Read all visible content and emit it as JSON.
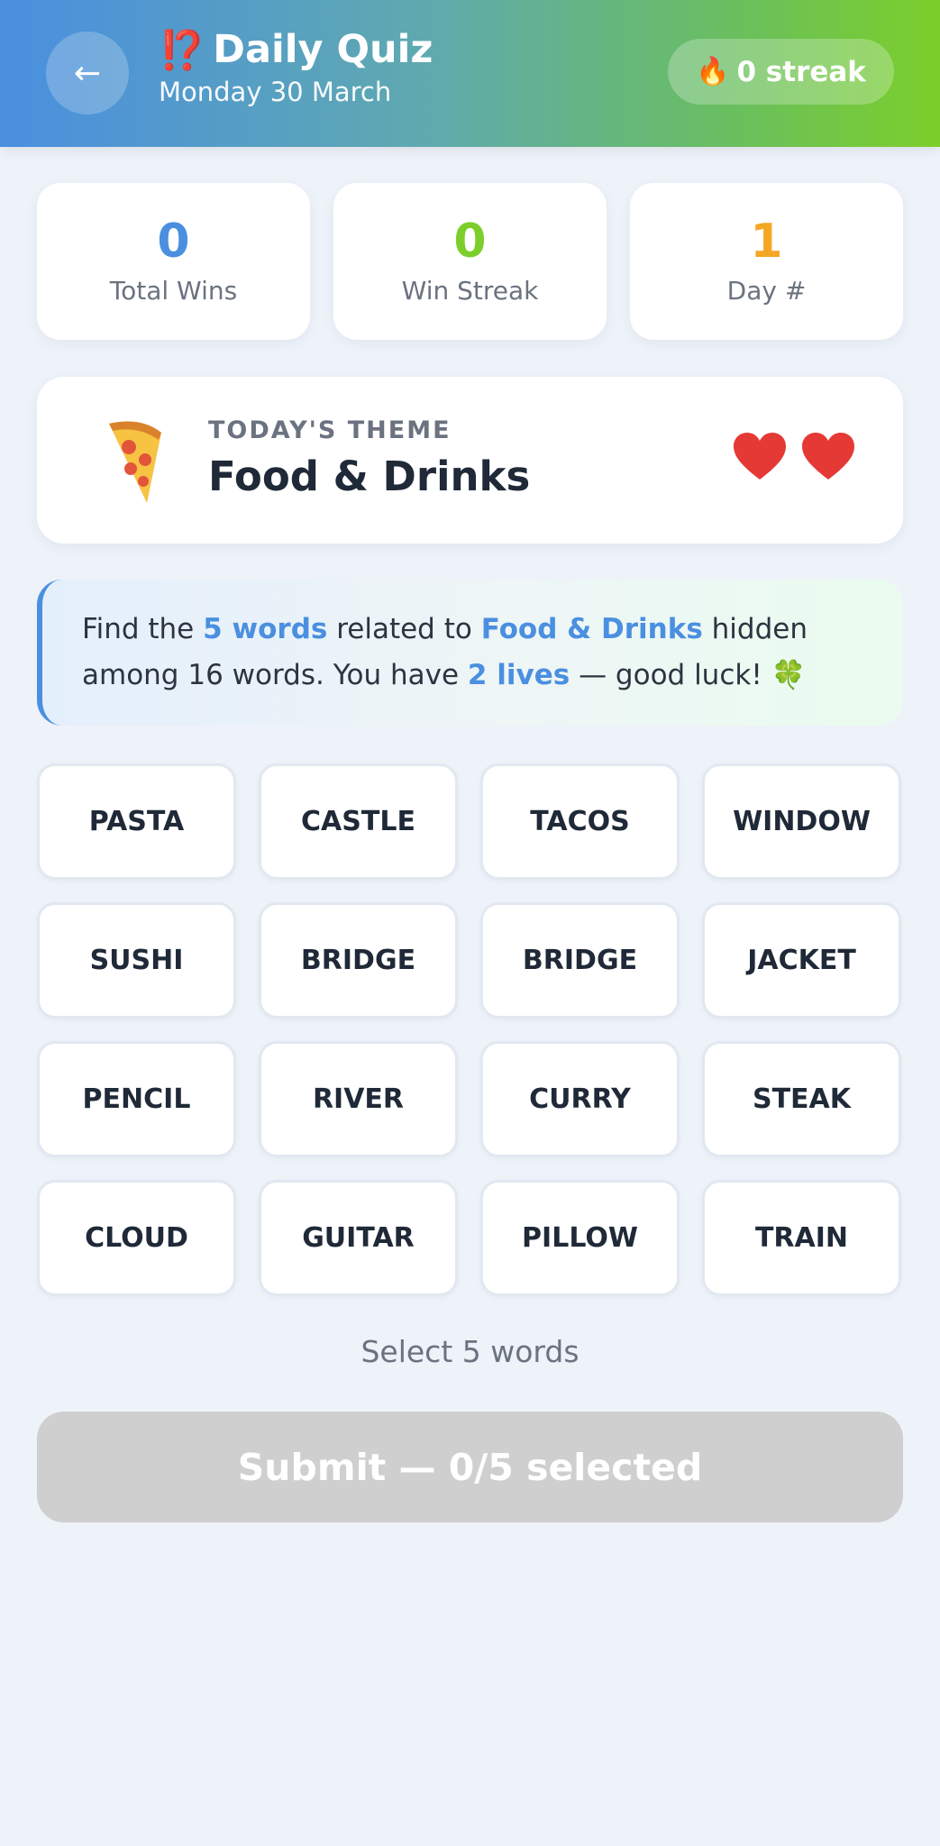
{
  "header": {
    "back_icon": "arrow-left-icon",
    "title_icon": "⁉️",
    "title": "Daily Quiz",
    "date": "Monday 30 March",
    "streak_icon": "fire-icon",
    "streak_label": "0 streak"
  },
  "stats": [
    {
      "value": "0",
      "label": "Total Wins",
      "color": "#4a8fe0"
    },
    {
      "value": "0",
      "label": "Win Streak",
      "color": "#7ccf2a"
    },
    {
      "value": "1",
      "label": "Day #",
      "color": "#f5a623"
    }
  ],
  "theme": {
    "icon": "pizza-icon",
    "label": "TODAY'S THEME",
    "name": "Food & Drinks",
    "lives": 2,
    "heart_icon": "heart-icon",
    "heart_color": "#e53935"
  },
  "instructions": {
    "part1": "Find the ",
    "count_text": "5 words",
    "part2": " related to ",
    "theme_text": "Food & Drinks",
    "part3": " hidden among 16 words. You have ",
    "lives_text": "2 lives",
    "part4": " — good luck! ",
    "end_icon": "🍀"
  },
  "words": [
    "PASTA",
    "CASTLE",
    "TACOS",
    "WINDOW",
    "SUSHI",
    "BRIDGE",
    "BRIDGE",
    "JACKET",
    "PENCIL",
    "RIVER",
    "CURRY",
    "STEAK",
    "CLOUD",
    "GUITAR",
    "PILLOW",
    "TRAIN"
  ],
  "hint": "Select 5 words",
  "submit_label": "Submit — 0/5 selected"
}
